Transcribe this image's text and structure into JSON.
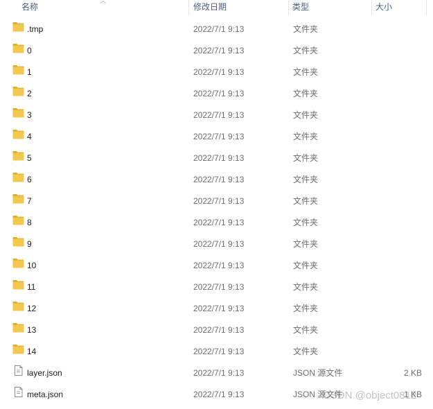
{
  "columns": {
    "name": "名称",
    "date": "修改日期",
    "type": "类型",
    "size": "大小"
  },
  "rows": [
    {
      "name": ".tmp",
      "date": "2022/7/1 9:13",
      "type": "文件夹",
      "size": "",
      "icon": "folder-icon"
    },
    {
      "name": "0",
      "date": "2022/7/1 9:13",
      "type": "文件夹",
      "size": "",
      "icon": "folder-icon"
    },
    {
      "name": "1",
      "date": "2022/7/1 9:13",
      "type": "文件夹",
      "size": "",
      "icon": "folder-icon"
    },
    {
      "name": "2",
      "date": "2022/7/1 9:13",
      "type": "文件夹",
      "size": "",
      "icon": "folder-icon"
    },
    {
      "name": "3",
      "date": "2022/7/1 9:13",
      "type": "文件夹",
      "size": "",
      "icon": "folder-icon"
    },
    {
      "name": "4",
      "date": "2022/7/1 9:13",
      "type": "文件夹",
      "size": "",
      "icon": "folder-icon"
    },
    {
      "name": "5",
      "date": "2022/7/1 9:13",
      "type": "文件夹",
      "size": "",
      "icon": "folder-icon"
    },
    {
      "name": "6",
      "date": "2022/7/1 9:13",
      "type": "文件夹",
      "size": "",
      "icon": "folder-icon"
    },
    {
      "name": "7",
      "date": "2022/7/1 9:13",
      "type": "文件夹",
      "size": "",
      "icon": "folder-icon"
    },
    {
      "name": "8",
      "date": "2022/7/1 9:13",
      "type": "文件夹",
      "size": "",
      "icon": "folder-icon"
    },
    {
      "name": "9",
      "date": "2022/7/1 9:13",
      "type": "文件夹",
      "size": "",
      "icon": "folder-icon"
    },
    {
      "name": "10",
      "date": "2022/7/1 9:13",
      "type": "文件夹",
      "size": "",
      "icon": "folder-icon"
    },
    {
      "name": "11",
      "date": "2022/7/1 9:13",
      "type": "文件夹",
      "size": "",
      "icon": "folder-icon"
    },
    {
      "name": "12",
      "date": "2022/7/1 9:13",
      "type": "文件夹",
      "size": "",
      "icon": "folder-icon"
    },
    {
      "name": "13",
      "date": "2022/7/1 9:13",
      "type": "文件夹",
      "size": "",
      "icon": "folder-icon"
    },
    {
      "name": "14",
      "date": "2022/7/1 9:13",
      "type": "文件夹",
      "size": "",
      "icon": "folder-icon"
    },
    {
      "name": "layer.json",
      "date": "2022/7/1 9:13",
      "type": "JSON 源文件",
      "size": "2 KB",
      "icon": "file-icon"
    },
    {
      "name": "meta.json",
      "date": "2022/7/1 9:13",
      "type": "JSON 源文件",
      "size": "1 KB",
      "icon": "file-icon"
    }
  ],
  "watermark": "CSDN @object0812",
  "colors": {
    "folder": "#f2c94c",
    "folder_tab": "#e2ad2b",
    "header_text": "#4c607a",
    "secondary_text": "#6d6d6d"
  }
}
